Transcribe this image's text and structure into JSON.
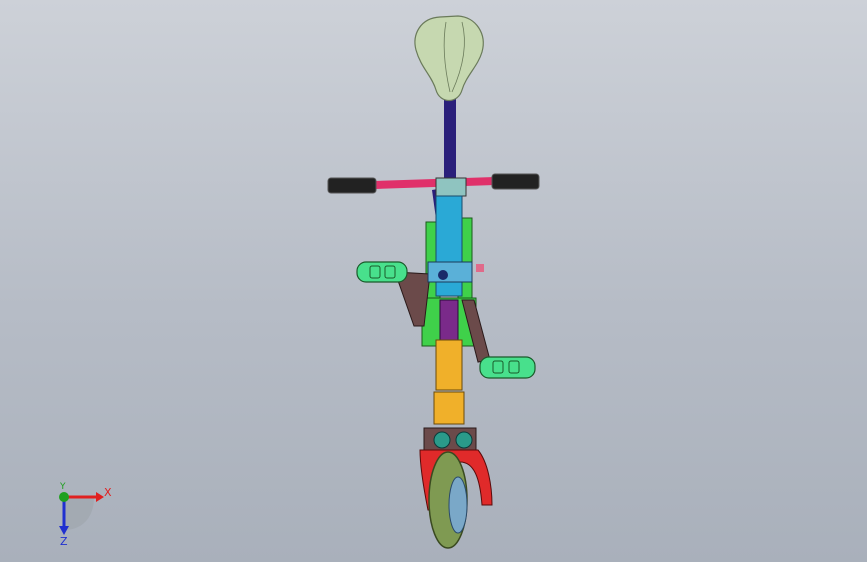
{
  "viewport": {
    "background_top": "#cdd1d8",
    "background_bottom": "#a9b0bb"
  },
  "model": {
    "parts": [
      "seat",
      "seat-post",
      "handlebar",
      "handle-grip-left",
      "handle-grip-right",
      "frame",
      "pedal-left",
      "pedal-right",
      "fork",
      "shock-absorber",
      "front-fender",
      "front-wheel"
    ],
    "colors": {
      "seat": "#c6d8b0",
      "seat_post": "#2a1f7a",
      "handlebar": "#e0306a",
      "grip": "#222222",
      "frame_green": "#3fd14a",
      "frame_cyan": "#2aa9d6",
      "pedal": "#48e08c",
      "crank": "#6b4a4a",
      "fork_orange": "#f0b02a",
      "fender_red": "#e02a2a",
      "wheel": "#7f9a52"
    }
  },
  "triad": {
    "x_label": "X",
    "y_label": "Y",
    "z_label": "Z",
    "x_color": "#e02020",
    "y_color": "#1fa01f",
    "z_color": "#2030d0"
  }
}
